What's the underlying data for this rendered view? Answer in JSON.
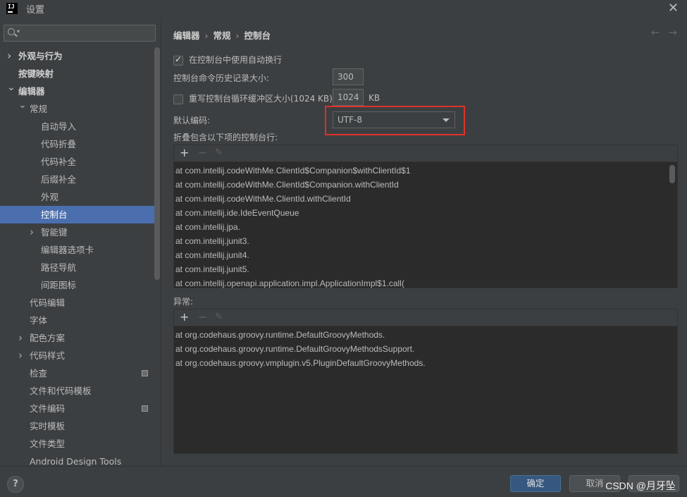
{
  "window": {
    "title": "设置",
    "logo_text": "IJ"
  },
  "search": {
    "placeholder": ""
  },
  "tree": [
    {
      "label": "外观与行为",
      "indent": 26,
      "chevron": "right",
      "bold": true
    },
    {
      "label": "按键映射",
      "indent": 26,
      "bold": true
    },
    {
      "label": "编辑器",
      "indent": 26,
      "chevron": "down",
      "bold": true
    },
    {
      "label": "常规",
      "indent": 42,
      "chevron": "down"
    },
    {
      "label": "自动导入",
      "indent": 58
    },
    {
      "label": "代码折叠",
      "indent": 58
    },
    {
      "label": "代码补全",
      "indent": 58
    },
    {
      "label": "后缀补全",
      "indent": 58
    },
    {
      "label": "外观",
      "indent": 58
    },
    {
      "label": "控制台",
      "indent": 58,
      "selected": true
    },
    {
      "label": "智能键",
      "indent": 58,
      "chevron": "right"
    },
    {
      "label": "编辑器选项卡",
      "indent": 58
    },
    {
      "label": "路径导航",
      "indent": 58
    },
    {
      "label": "间距图标",
      "indent": 58
    },
    {
      "label": "代码编辑",
      "indent": 42
    },
    {
      "label": "字体",
      "indent": 42
    },
    {
      "label": "配色方案",
      "indent": 42,
      "chevron": "right"
    },
    {
      "label": "代码样式",
      "indent": 42,
      "chevron": "right"
    },
    {
      "label": "检查",
      "indent": 42,
      "icon": true
    },
    {
      "label": "文件和代码模板",
      "indent": 42
    },
    {
      "label": "文件编码",
      "indent": 42,
      "icon": true
    },
    {
      "label": "实时模板",
      "indent": 42
    },
    {
      "label": "文件类型",
      "indent": 42
    },
    {
      "label": "Android Design Tools",
      "indent": 42
    }
  ],
  "breadcrumb": {
    "part1": "编辑器",
    "part2": "常规",
    "part3": "控制台",
    "sep": "›"
  },
  "nav": {
    "back": "←",
    "forward": "→"
  },
  "settings": {
    "soft_wrap_label": "在控制台中使用自动换行",
    "history_label": "控制台命令历史记录大小:",
    "history_value": "300",
    "override_label": "重写控制台循环缓冲区大小(1024 KB)",
    "override_value": "1024",
    "override_unit": "KB",
    "encoding_label": "默认编码:",
    "encoding_value": "UTF-8",
    "fold_label": "折叠包含以下项的控制台行:",
    "exceptions_label": "异常:"
  },
  "fold_lines": [
    "at com.intellij.codeWithMe.ClientId$Companion$withClientId$1",
    "at com.intellij.codeWithMe.ClientId$Companion.withClientId",
    "at com.intellij.codeWithMe.ClientId.withClientId",
    "at com.intellij.ide.IdeEventQueue",
    "at com.intellij.jpa.",
    "at com.intellij.junit3.",
    "at com.intellij.junit4.",
    "at com.intellij.junit5.",
    "at com.intellij.openapi.application.impl.ApplicationImpl$1.call("
  ],
  "exception_lines": [
    "at org.codehaus.groovy.runtime.DefaultGroovyMethods.",
    "at org.codehaus.groovy.runtime.DefaultGroovyMethodsSupport.",
    "at org.codehaus.groovy.vmplugin.v5.PluginDefaultGroovyMethods."
  ],
  "toolbar": {
    "add": "+",
    "remove": "−",
    "edit": "✎"
  },
  "footer": {
    "help": "?",
    "ok": "确定",
    "cancel": "取消",
    "apply": "",
    "watermark": "CSDN @月牙坠"
  }
}
